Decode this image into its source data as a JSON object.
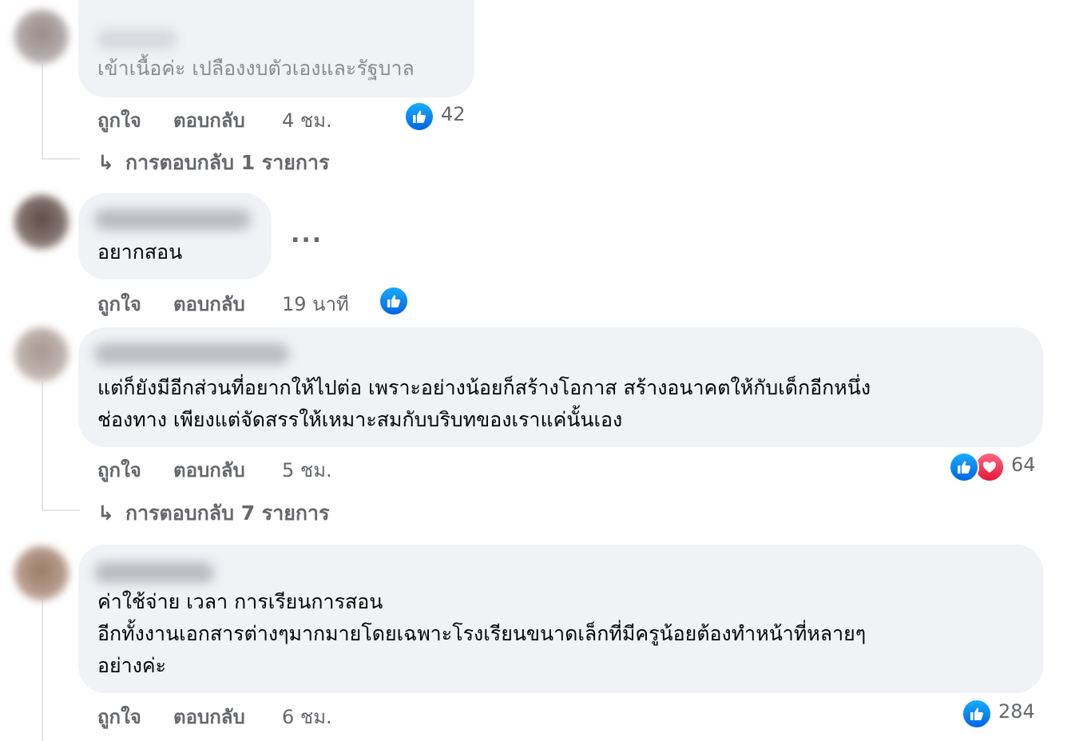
{
  "comments": [
    {
      "text_lines": [
        "เข้าเนื้อค่ะ เปลืองงบตัวเองและรัฐบาล"
      ],
      "actions": {
        "like": "ถูกใจ",
        "reply": "ตอบกลับ",
        "time": "4 ชม."
      },
      "reactions": {
        "icons": [
          "like-icon"
        ],
        "count": "42"
      },
      "replies": "การตอบกลับ 1 รายการ"
    },
    {
      "text_lines": [
        "อยากสอน"
      ],
      "more": "...",
      "actions": {
        "like": "ถูกใจ",
        "reply": "ตอบกลับ",
        "time": "19 นาที"
      },
      "reactions": {
        "icons": [
          "like-icon"
        ],
        "count": ""
      }
    },
    {
      "text_lines": [
        "แต่ก็ยังมีอีกส่วนที่อยากให้ไปต่อ เพราะอย่างน้อยก็สร้างโอกาส สร้างอนาคตให้กับเด็กอีกหนึ่ง",
        "ช่องทาง เพียงแต่จัดสรรให้เหมาะสมกับบริบทของเราแค่นั้นเอง"
      ],
      "actions": {
        "like": "ถูกใจ",
        "reply": "ตอบกลับ",
        "time": "5 ชม."
      },
      "reactions": {
        "icons": [
          "like-icon",
          "love-icon"
        ],
        "count": "64"
      },
      "replies": "การตอบกลับ 7 รายการ"
    },
    {
      "text_lines": [
        "ค่าใช้จ่าย เวลา การเรียนการสอน",
        "อีกทั้งงานเอกสารต่างๆมากมายโดยเฉพาะโรงเรียนขนาดเล็กที่มีครูน้อยต้องทำหน้าที่หลายๆ",
        "อย่างค่ะ"
      ],
      "actions": {
        "like": "ถูกใจ",
        "reply": "ตอบกลับ",
        "time": "6 ชม."
      },
      "reactions": {
        "icons": [
          "like-icon"
        ],
        "count": "284"
      }
    }
  ],
  "colors": {
    "bubble": "#f0f2f5",
    "secondary_text": "#65676b",
    "like_blue": "#0866ff",
    "love_red": "#f33e58"
  }
}
